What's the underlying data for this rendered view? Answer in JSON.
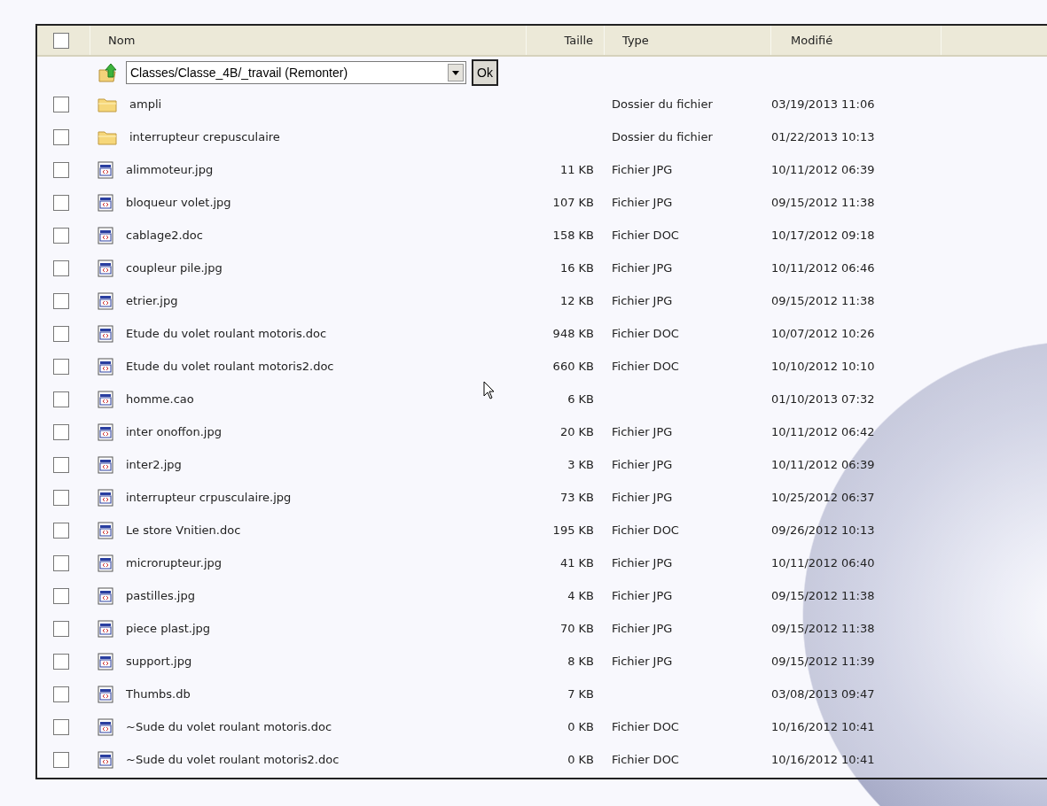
{
  "table": {
    "select_all_checked": false,
    "columns": [
      "Nom",
      "Taille",
      "Type",
      "Modifié"
    ],
    "path_selector": {
      "value": "Classes/Classe_4B/_travail (Remonter)",
      "button": "Ok"
    },
    "rows": [
      {
        "kind": "folder",
        "name": "ampli",
        "size": "",
        "type": "Dossier du fichier",
        "modified": "03/19/2013 11:06",
        "checked": false
      },
      {
        "kind": "folder",
        "name": "interrupteur crepusculaire",
        "size": "",
        "type": "Dossier du fichier",
        "modified": "01/22/2013 10:13",
        "checked": false
      },
      {
        "kind": "file",
        "name": "alimmoteur.jpg",
        "size": "11 KB",
        "type": "Fichier JPG",
        "modified": "10/11/2012 06:39",
        "checked": false
      },
      {
        "kind": "file",
        "name": "bloqueur volet.jpg",
        "size": "107 KB",
        "type": "Fichier JPG",
        "modified": "09/15/2012 11:38",
        "checked": false
      },
      {
        "kind": "file",
        "name": "cablage2.doc",
        "size": "158 KB",
        "type": "Fichier DOC",
        "modified": "10/17/2012 09:18",
        "checked": false
      },
      {
        "kind": "file",
        "name": "coupleur pile.jpg",
        "size": "16 KB",
        "type": "Fichier JPG",
        "modified": "10/11/2012 06:46",
        "checked": false
      },
      {
        "kind": "file",
        "name": "etrier.jpg",
        "size": "12 KB",
        "type": "Fichier JPG",
        "modified": "09/15/2012 11:38",
        "checked": false
      },
      {
        "kind": "file",
        "name": "Etude du volet roulant motoris.doc",
        "size": "948 KB",
        "type": "Fichier DOC",
        "modified": "10/07/2012 10:26",
        "checked": false
      },
      {
        "kind": "file",
        "name": "Etude du volet roulant motoris2.doc",
        "size": "660 KB",
        "type": "Fichier DOC",
        "modified": "10/10/2012 10:10",
        "checked": false
      },
      {
        "kind": "file",
        "name": "homme.cao",
        "size": "6 KB",
        "type": "",
        "modified": "01/10/2013 07:32",
        "checked": false
      },
      {
        "kind": "file",
        "name": "inter onoffon.jpg",
        "size": "20 KB",
        "type": "Fichier JPG",
        "modified": "10/11/2012 06:42",
        "checked": false
      },
      {
        "kind": "file",
        "name": "inter2.jpg",
        "size": "3 KB",
        "type": "Fichier JPG",
        "modified": "10/11/2012 06:39",
        "checked": false
      },
      {
        "kind": "file",
        "name": "interrupteur crpusculaire.jpg",
        "size": "73 KB",
        "type": "Fichier JPG",
        "modified": "10/25/2012 06:37",
        "checked": false
      },
      {
        "kind": "file",
        "name": "Le store Vnitien.doc",
        "size": "195 KB",
        "type": "Fichier DOC",
        "modified": "09/26/2012 10:13",
        "checked": false
      },
      {
        "kind": "file",
        "name": "microrupteur.jpg",
        "size": "41 KB",
        "type": "Fichier JPG",
        "modified": "10/11/2012 06:40",
        "checked": false
      },
      {
        "kind": "file",
        "name": "pastilles.jpg",
        "size": "4 KB",
        "type": "Fichier JPG",
        "modified": "09/15/2012 11:38",
        "checked": false
      },
      {
        "kind": "file",
        "name": "piece plast.jpg",
        "size": "70 KB",
        "type": "Fichier JPG",
        "modified": "09/15/2012 11:38",
        "checked": false
      },
      {
        "kind": "file",
        "name": "support.jpg",
        "size": "8 KB",
        "type": "Fichier JPG",
        "modified": "09/15/2012 11:39",
        "checked": false
      },
      {
        "kind": "file",
        "name": "Thumbs.db",
        "size": "7 KB",
        "type": "",
        "modified": "03/08/2013 09:47",
        "checked": false
      },
      {
        "kind": "file",
        "name": "~Sude du volet roulant motoris.doc",
        "size": "0 KB",
        "type": "Fichier DOC",
        "modified": "10/16/2012 10:41",
        "checked": false
      },
      {
        "kind": "file",
        "name": "~Sude du volet roulant motoris2.doc",
        "size": "0 KB",
        "type": "Fichier DOC",
        "modified": "10/16/2012 10:41",
        "checked": false
      }
    ]
  }
}
